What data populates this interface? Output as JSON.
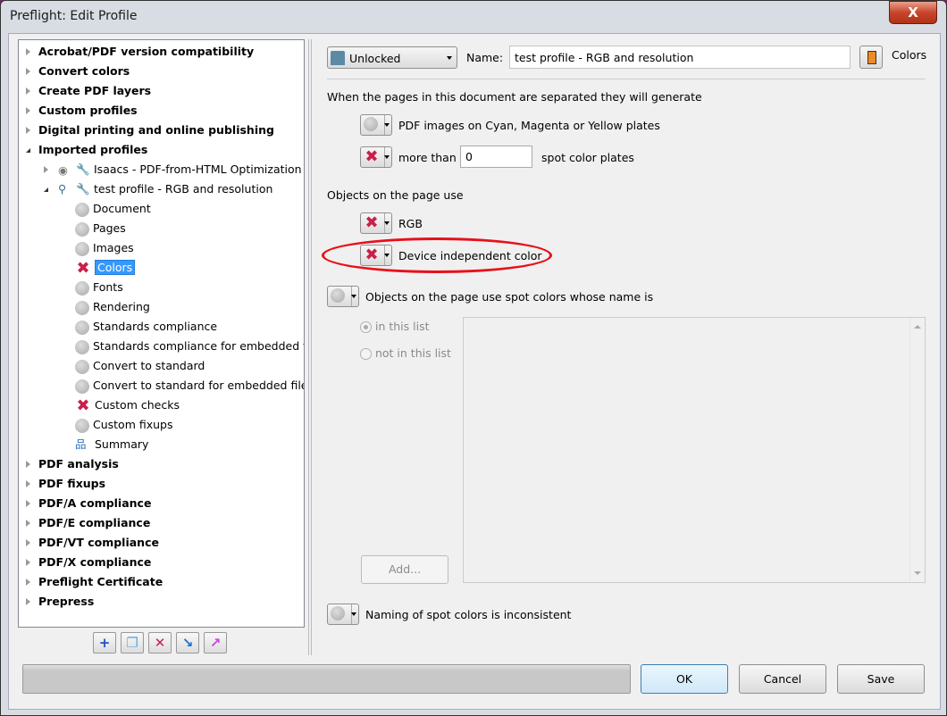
{
  "window": {
    "title": "Preflight: Edit Profile",
    "close_label": "X"
  },
  "tree": {
    "top_items": [
      "Acrobat/PDF version compatibility",
      "Convert colors",
      "Create PDF layers",
      "Custom profiles",
      "Digital printing and online publishing",
      "Imported profiles"
    ],
    "profiles": [
      "Isaacs - PDF-from-HTML Optimization",
      "test profile - RGB and resolution"
    ],
    "children": [
      {
        "label": "Document",
        "status": "inactive"
      },
      {
        "label": "Pages",
        "status": "inactive"
      },
      {
        "label": "Images",
        "status": "inactive"
      },
      {
        "label": "Colors",
        "status": "error",
        "selected": true
      },
      {
        "label": "Fonts",
        "status": "inactive"
      },
      {
        "label": "Rendering",
        "status": "inactive"
      },
      {
        "label": "Standards compliance",
        "status": "inactive"
      },
      {
        "label": "Standards compliance for embedded fil",
        "status": "inactive"
      },
      {
        "label": "Convert to standard",
        "status": "inactive"
      },
      {
        "label": "Convert to standard for embedded files",
        "status": "inactive"
      },
      {
        "label": "Custom checks",
        "status": "error"
      },
      {
        "label": "Custom fixups",
        "status": "inactive"
      },
      {
        "label": "Summary",
        "status": "summary"
      }
    ],
    "bottom_items": [
      "PDF analysis",
      "PDF fixups",
      "PDF/A compliance",
      "PDF/E compliance",
      "PDF/VT compliance",
      "PDF/X compliance",
      "Preflight Certificate",
      "Prepress"
    ]
  },
  "toolbar_icons": [
    "add-icon",
    "duplicate-icon",
    "delete-icon",
    "import-icon",
    "export-icon"
  ],
  "header": {
    "lock_select": "Unlocked",
    "name_label": "Name:",
    "name_value": "test profile - RGB and resolution",
    "section_label": "Colors"
  },
  "sep_section": {
    "heading": "When the pages in this document are separated they will generate",
    "images_label": "PDF images on Cyan, Magenta or Yellow plates",
    "more_than": "more than",
    "plates_value": "0",
    "plates_label": "spot color plates"
  },
  "objects_section": {
    "heading": "Objects on the page use",
    "rgb": "RGB",
    "device_independent": "Device independent color"
  },
  "spot_section": {
    "heading": "Objects on the page use spot colors whose name is",
    "in_list": "in this list",
    "not_in_list": "not in this list",
    "add": "Add..."
  },
  "naming": "Naming of spot colors is inconsistent",
  "buttons": {
    "ok": "OK",
    "cancel": "Cancel",
    "save": "Save"
  },
  "colors": {
    "error": "#c8204a",
    "highlight_ellipse": "#e8101a",
    "selection": "#3399ff"
  }
}
